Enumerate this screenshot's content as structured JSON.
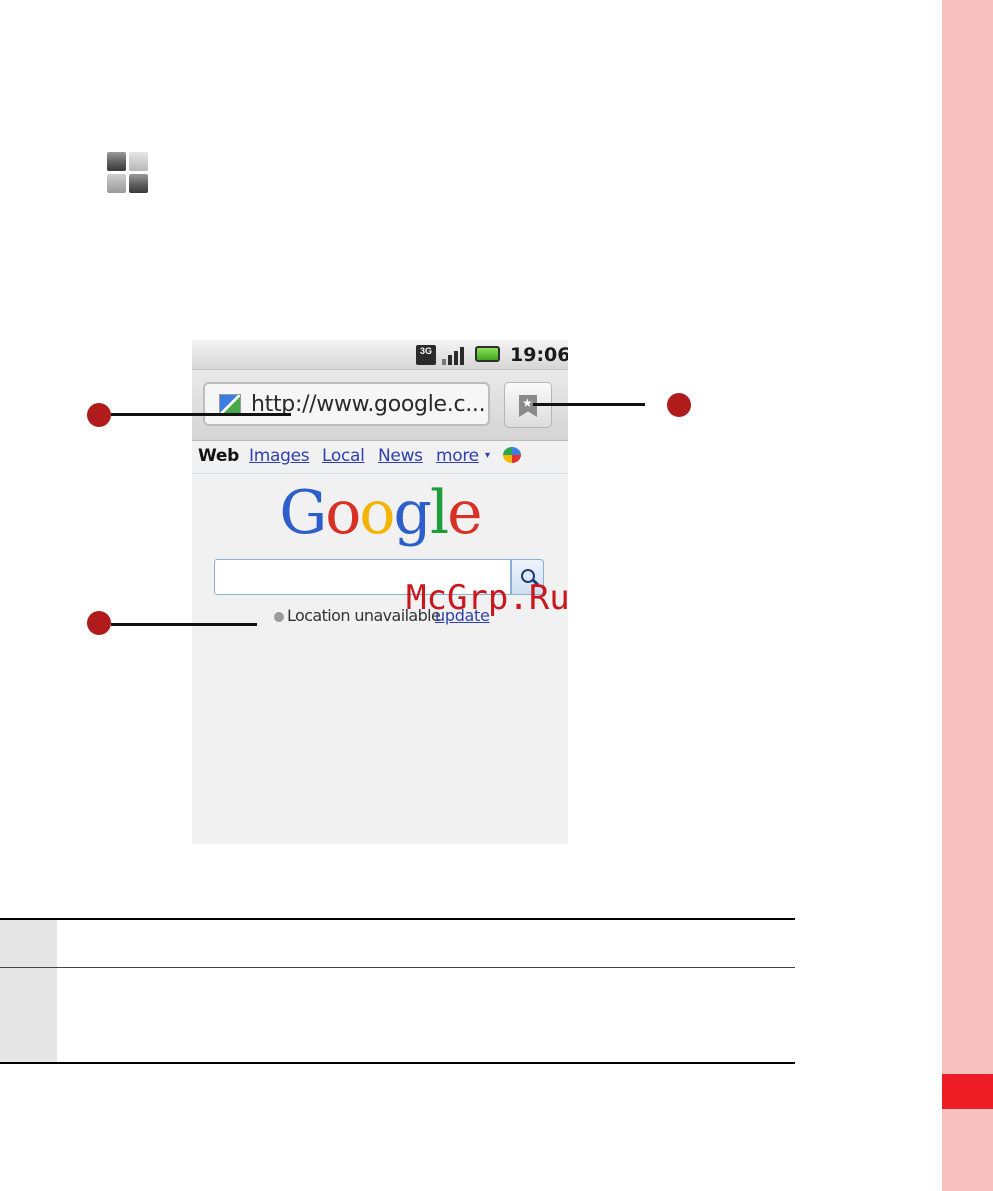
{
  "phone": {
    "status_network": "3G",
    "status_time": "19:06",
    "url": "http://www.google.c...",
    "nav_items": [
      "Web",
      "Images",
      "Local",
      "News",
      "more"
    ],
    "nav_more_arrow": "▾",
    "logo_letters": [
      {
        "char": "G",
        "color": "#2c5fcb"
      },
      {
        "char": "o",
        "color": "#d93025"
      },
      {
        "char": "o",
        "color": "#f2b400"
      },
      {
        "char": "g",
        "color": "#2c5fcb"
      },
      {
        "char": "l",
        "color": "#1f9d3b"
      },
      {
        "char": "e",
        "color": "#d93025"
      }
    ],
    "location_text": "Location unavailable",
    "location_link": "update"
  },
  "watermark": "McGrp.Ru",
  "icons": {
    "menu": "menu-grid-icon",
    "favicon": "google-favicon-icon",
    "bookmark": "bookmark-icon",
    "search": "search-icon",
    "chat": "google-chat-icon"
  },
  "colors": {
    "side_strip": "#f9c0c0",
    "side_marker": "#ee1c25",
    "callout": "#b01c1c",
    "link": "#2f3fb0"
  }
}
